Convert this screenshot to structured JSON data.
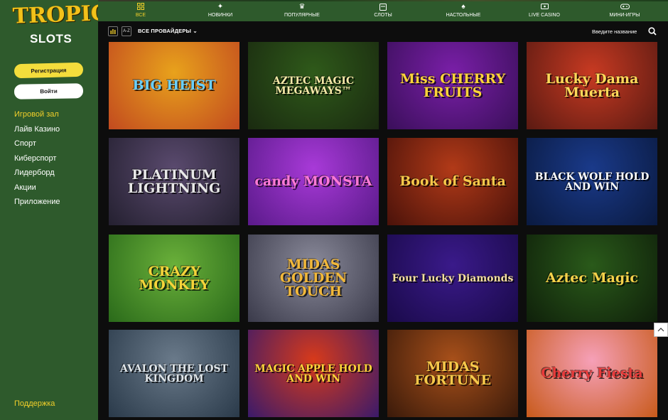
{
  "brand": {
    "logo_top": "TROPIC",
    "logo_bottom": "SLOTS"
  },
  "auth": {
    "register_label": "Регистрация",
    "login_label": "Войти"
  },
  "sidebar": {
    "items": [
      {
        "label": "Игровой зал",
        "active": true
      },
      {
        "label": "Лайв Казино"
      },
      {
        "label": "Спорт"
      },
      {
        "label": "Киберспорт"
      },
      {
        "label": "Лидерборд"
      },
      {
        "label": "Акции"
      },
      {
        "label": "Приложение"
      }
    ],
    "support_label": "Поддержка"
  },
  "tabs": [
    {
      "label": "ВСЕ",
      "icon": "grid-icon",
      "active": true
    },
    {
      "label": "НОВИНКИ",
      "icon": "sparkle-icon"
    },
    {
      "label": "ПОПУЛЯРНЫЕ",
      "icon": "crown-icon"
    },
    {
      "label": "СЛОТЫ",
      "icon": "slot-machine-icon"
    },
    {
      "label": "НАСТОЛЬНЫЕ",
      "icon": "cards-icon"
    },
    {
      "label": "LIVE CASINO",
      "icon": "live-tv-icon"
    },
    {
      "label": "МИНИ-ИГРЫ",
      "icon": "gamepad-icon"
    }
  ],
  "filters": {
    "bars_label": "",
    "az_label": "A-Z",
    "providers_label": "ВСЕ ПРОВАЙДЕРЫ",
    "search_placeholder": "Введите название"
  },
  "games": [
    {
      "title": "BIG HEIST",
      "bg": "#e8a21c",
      "bg2": "#c24a1f",
      "fg": "#6ad0ff"
    },
    {
      "title": "AZTEC MAGIC MEGAWAYS™",
      "bg": "#2f5a1a",
      "bg2": "#1a2a10",
      "fg": "#f6e9a8"
    },
    {
      "title": "Miss CHERRY FRUITS",
      "bg": "#7a1fa8",
      "bg2": "#3a0f5a",
      "fg": "#ffd43a"
    },
    {
      "title": "Lucky Dama Muerta",
      "bg": "#c83a22",
      "bg2": "#5a1a12",
      "fg": "#ffd95a"
    },
    {
      "title": "PLATINUM LIGHTNING",
      "bg": "#5a4a6e",
      "bg2": "#242030",
      "fg": "#e8e8e8"
    },
    {
      "title": "candy MONSTA",
      "bg": "#a83ad8",
      "bg2": "#5a1a8a",
      "fg": "#ff7ad6"
    },
    {
      "title": "Book of Santa",
      "bg": "#b23a18",
      "bg2": "#4a120a",
      "fg": "#f6c84a"
    },
    {
      "title": "BLACK WOLF HOLD AND WIN",
      "bg": "#1a3a8a",
      "bg2": "#0a1a40",
      "fg": "#ffffff"
    },
    {
      "title": "CRAZY MONKEY",
      "bg": "#6ab03a",
      "bg2": "#2a6a1a",
      "fg": "#f6d43a"
    },
    {
      "title": "MIDAS GOLDEN TOUCH",
      "bg": "#8a8a9a",
      "bg2": "#3a3a4a",
      "fg": "#f2b83a"
    },
    {
      "title": "Four Lucky Diamonds",
      "bg": "#3a1a8a",
      "bg2": "#1a0a4a",
      "fg": "#f6e0a0"
    },
    {
      "title": "Aztec Magic",
      "bg": "#2a5a1a",
      "bg2": "#0f200a",
      "fg": "#f6d24a"
    },
    {
      "title": "AVALON THE LOST KINGDOM",
      "bg": "#6a7a8a",
      "bg2": "#2a3a4a",
      "fg": "#e0e6ea"
    },
    {
      "title": "MAGIC APPLE HOLD AND WIN",
      "bg": "#d83a1a",
      "bg2": "#3a1a6a",
      "fg": "#ffd43a"
    },
    {
      "title": "MIDAS FORTUNE",
      "bg": "#a8501a",
      "bg2": "#3a1a0a",
      "fg": "#f6c84a"
    },
    {
      "title": "Cherry Fiesta",
      "bg": "#f6a0b8",
      "bg2": "#c85a1a",
      "fg": "#e83a3a"
    }
  ],
  "colors": {
    "sidebar_bg": "#2e5a2c",
    "accent": "#f2cf2a",
    "page_bg": "#0d0d0d"
  }
}
